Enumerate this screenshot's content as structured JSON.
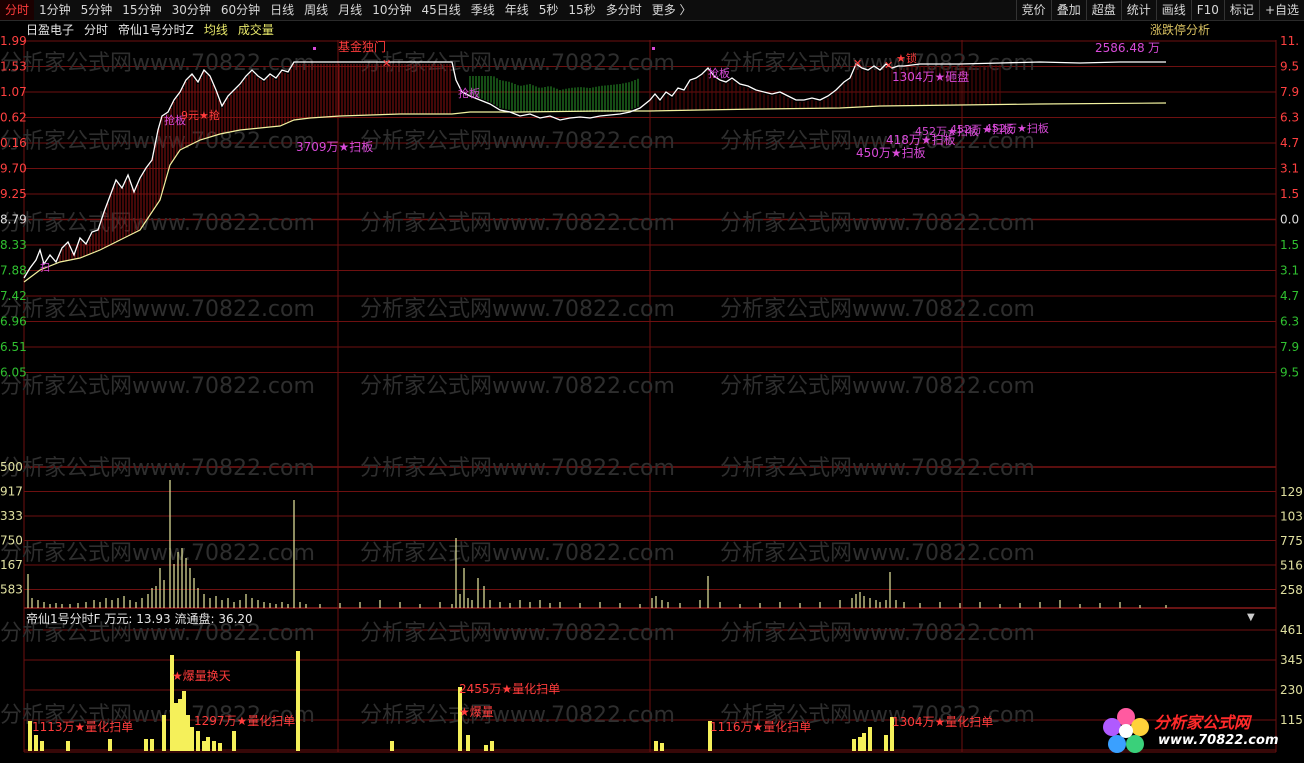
{
  "toolbar": {
    "left": [
      "分时",
      "1分钟",
      "5分钟",
      "15分钟",
      "30分钟",
      "60分钟",
      "日线",
      "周线",
      "月线",
      "10分钟",
      "45日线",
      "季线",
      "年线",
      "5秒",
      "15秒",
      "多分时",
      "更多 〉"
    ],
    "active_index": 0,
    "right": [
      "竞价",
      "叠加",
      "超盘",
      "统计",
      "画线",
      "F10",
      "标记",
      "+自选"
    ]
  },
  "header": {
    "stock_name": "日盈电子",
    "period": "分时",
    "indicator": "帝仙1号分时Z",
    "avg_label": "均线",
    "vol_label": "成交量",
    "limit_analysis": "涨跌停分析"
  },
  "axes": {
    "price_left": [
      "1.99",
      "1.53",
      "1.07",
      "0.62",
      "0.16",
      "9.70",
      "9.25",
      "8.79",
      "8.33",
      "7.88",
      "7.42",
      "6.96",
      "6.51",
      "6.05"
    ],
    "price_right": [
      "11.",
      "9.5",
      "7.9",
      "6.3",
      "4.7",
      "3.1",
      "1.5",
      "0.0",
      "1.5",
      "3.1",
      "4.7",
      "6.3",
      "7.9",
      "9.5"
    ],
    "volume_left": [
      "500",
      "917",
      "333",
      "750",
      "167",
      "583"
    ],
    "volume_right": [
      "129",
      "103",
      "775",
      "516",
      "258"
    ],
    "sub_right": [
      "461",
      "345",
      "230",
      "115"
    ]
  },
  "watermark": "分析家公式网www.70822.com",
  "sub_header": {
    "title": "帝仙1号分时F",
    "unit_label": "万元:",
    "unit_value": "13.93",
    "float_label": "流通盘:",
    "float_value": "36.20"
  },
  "annotations": {
    "fund_lone_door": "基金独门",
    "amount_2586": "2586.48",
    "amount_unit": "万",
    "scan_3709": "3709万★扫板",
    "scan_1304": "1304万★砸盘",
    "scan_418": "418万★扫板",
    "scan_450": "450万★扫板",
    "scan_overlap": "452万★扫板",
    "rob_board_1": "抢板",
    "rob_board_2": "抢板",
    "rob_board_3": "抢板",
    "yuan_9": "9元★抢",
    "lock": "★锁",
    "mark_x": "✕"
  },
  "sub_annotations": {
    "a1": "1113万★量化扫单",
    "a2": "★爆量换天",
    "a3": "1297万★量化扫单",
    "a4": "2455万★量化扫单",
    "a5": "★爆量",
    "a6": "1116万★量化扫单",
    "a7": "1304万★量化扫单"
  },
  "logo": {
    "brand": "分析家公式网",
    "url": "www.70822.com"
  },
  "colors": {
    "grid": "#6e1010",
    "price_line": "#ffffff",
    "avg_line": "#f2f2a0",
    "volume_bar": "#e8e8a0",
    "sub_bar": "#f5f05a",
    "up_bar": "#8a1010",
    "down_bar": "#2a9a2a",
    "annot_purple": "#d84ad8",
    "annot_red": "#ff3c3c"
  }
}
